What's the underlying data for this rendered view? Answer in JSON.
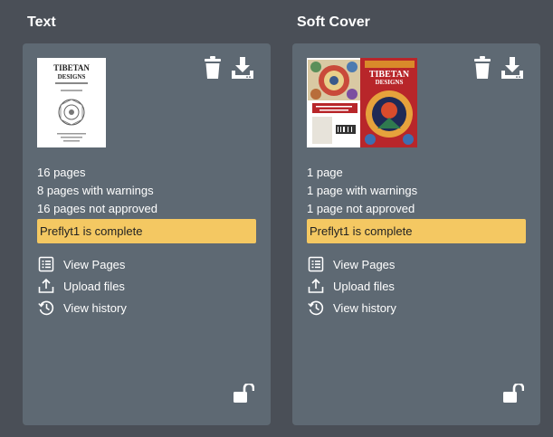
{
  "columns": [
    {
      "title": "Text",
      "thumbnail": {
        "title_line1": "TIBETAN",
        "title_line2": "DESIGNS"
      },
      "stats": [
        "16 pages",
        "8 pages with warnings",
        "16 pages not approved"
      ],
      "status": "Preflyt1 is complete",
      "actions": [
        "View Pages",
        "Upload files",
        "View history"
      ]
    },
    {
      "title": "Soft Cover",
      "thumbnail": {
        "title_line1": "TIBETAN",
        "title_line2": "DESIGNS"
      },
      "stats": [
        "1 page",
        "1 page with warnings",
        "1 page not approved"
      ],
      "status": "Preflyt1 is complete",
      "actions": [
        "View Pages",
        "Upload files",
        "View history"
      ]
    }
  ],
  "icons": {
    "delete": "trash-icon",
    "download": "download-icon",
    "view_pages": "list-icon",
    "upload": "upload-icon",
    "history": "history-icon",
    "lock": "unlock-icon"
  },
  "colors": {
    "background": "#4a4f57",
    "card": "#5e6973",
    "status": "#f4c862"
  }
}
